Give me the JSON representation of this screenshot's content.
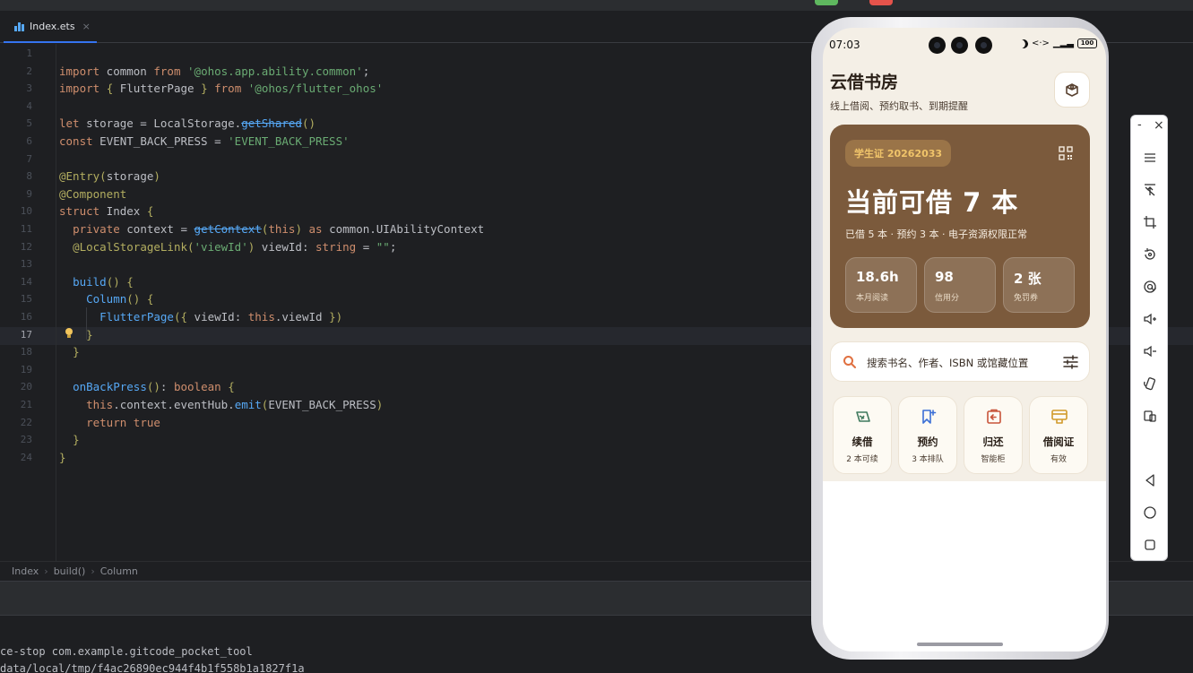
{
  "ide": {
    "tab_label": "Index.ets",
    "tab_close": "×",
    "line_numbers": [
      "1",
      "2",
      "3",
      "4",
      "5",
      "6",
      "7",
      "8",
      "9",
      "10",
      "11",
      "12",
      "13",
      "14",
      "15",
      "16",
      "17",
      "18",
      "19",
      "20",
      "21",
      "22",
      "23",
      "24"
    ],
    "breadcrumb": [
      "Index",
      "build()",
      "Column"
    ],
    "terminal_lines": [
      "ce-stop com.example.gitcode_pocket_tool",
      "data/local/tmp/f4ac26890ec944f4b1f558b1a1827f1a"
    ]
  },
  "code": [
    "",
    "import common from '@ohos.app.ability.common';",
    "import { FlutterPage } from '@ohos/flutter_ohos'",
    "",
    "let storage = LocalStorage.getShared()",
    "const EVENT_BACK_PRESS = 'EVENT_BACK_PRESS'",
    "",
    "@Entry(storage)",
    "@Component",
    "struct Index {",
    "  private context = getContext(this) as common.UIAbilityContext",
    "  @LocalStorageLink('viewId') viewId: string = \"\";",
    "",
    "  build() {",
    "    Column() {",
    "      FlutterPage({ viewId: this.viewId })",
    "    }",
    "  }",
    "",
    "  onBackPress(): boolean {",
    "    this.context.eventHub.emit(EVENT_BACK_PRESS)",
    "    return true",
    "  }",
    "}"
  ],
  "phone": {
    "status": {
      "time": "07:03",
      "battery": "100",
      "net": "<·>"
    },
    "app_title": "云借书房",
    "app_subtitle": "线上借阅、预约取书、到期提醒",
    "card": {
      "badge": "学生证 20262033",
      "headline": "当前可借 7 本",
      "subline": "已借 5 本 · 预约 3 本 · 电子资源权限正常",
      "stats": [
        {
          "value": "18.6h",
          "label": "本月阅读"
        },
        {
          "value": "98",
          "label": "信用分"
        },
        {
          "value": "2 张",
          "label": "免罚券"
        }
      ]
    },
    "search_placeholder": "搜索书名、作者、ISBN 或馆藏位置",
    "tiles": [
      {
        "title": "续借",
        "sub": "2 本可续",
        "icon": "renew-icon",
        "color": "#3f7a5e"
      },
      {
        "title": "预约",
        "sub": "3 本排队",
        "icon": "bookmark-add-icon",
        "color": "#3b6fd6"
      },
      {
        "title": "归还",
        "sub": "智能柜",
        "icon": "return-icon",
        "color": "#c8543a"
      },
      {
        "title": "借阅证",
        "sub": "有效",
        "icon": "card-icon",
        "color": "#d19a2b"
      }
    ],
    "colors": {
      "card": "#7b5a3c",
      "badge_text": "#f0c46a",
      "background": "#f4efe6",
      "accent_search": "#e07040"
    }
  },
  "emulator_toolbar": {
    "window_min": "-",
    "window_close": "×",
    "buttons": [
      "menu-icon",
      "pin-top-icon",
      "crop-icon",
      "rotate-icon",
      "location-icon",
      "volume-up-icon",
      "volume-down-icon",
      "shake-icon",
      "screenshot-icon",
      "back-icon",
      "home-icon",
      "recents-icon"
    ]
  }
}
